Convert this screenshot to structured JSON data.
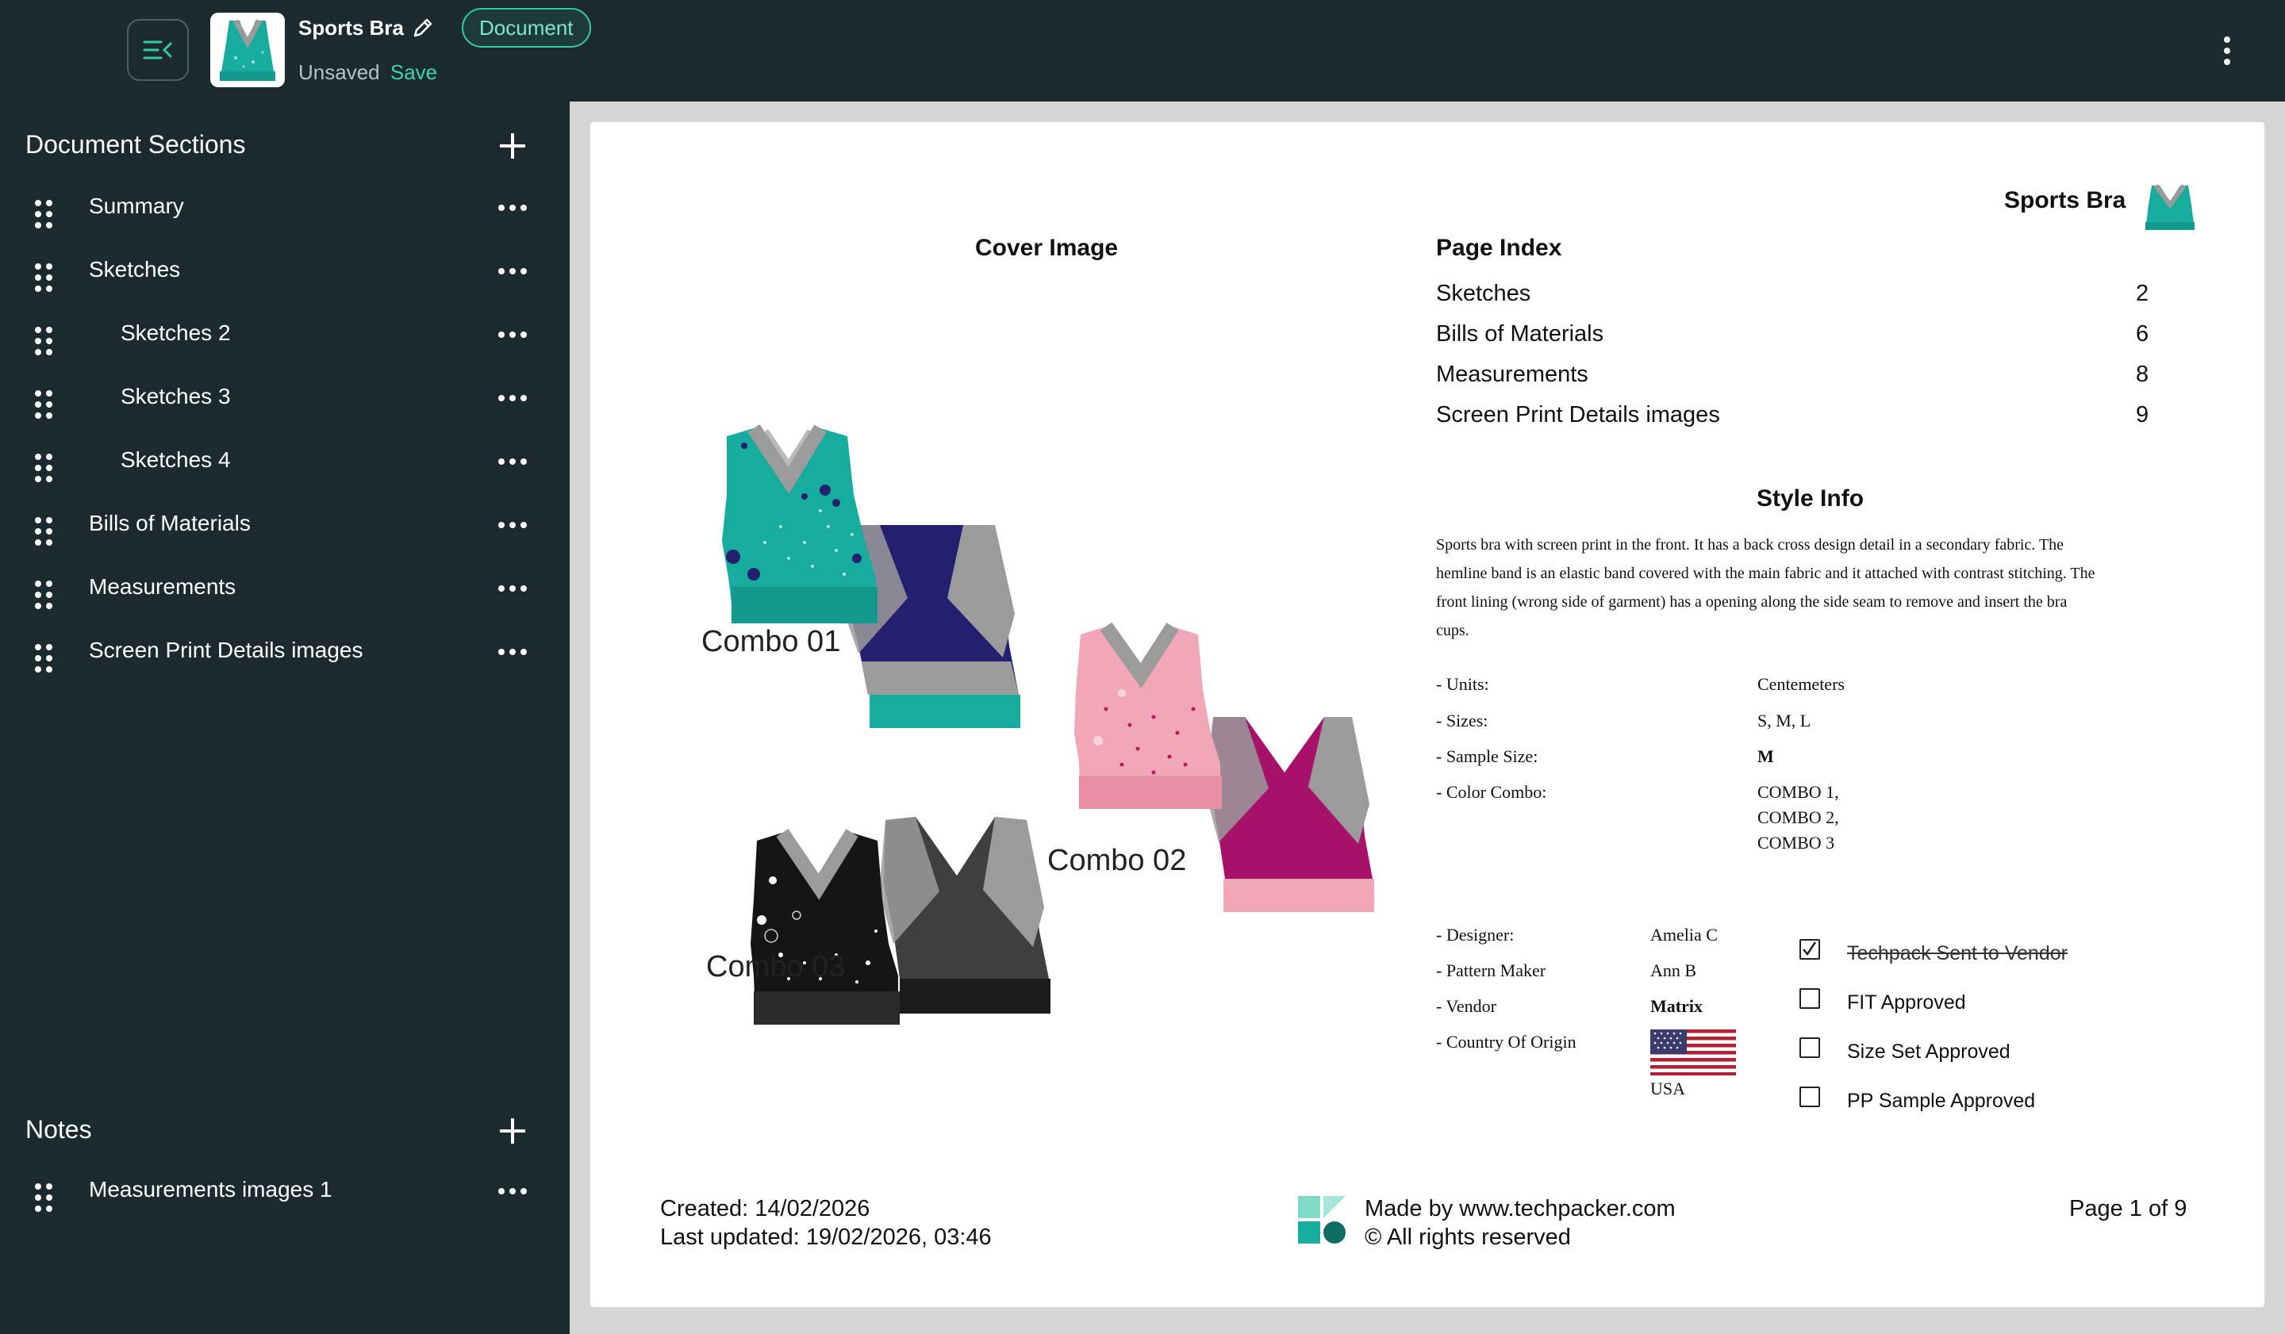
{
  "header": {
    "doc_title": "Sports Bra",
    "badge": "Document",
    "unsaved_text": "Unsaved",
    "save_label": "Save"
  },
  "sidebar": {
    "sections_title": "Document Sections",
    "items": [
      {
        "label": "Summary"
      },
      {
        "label": "Sketches"
      },
      {
        "label": "Sketches 2"
      },
      {
        "label": "Sketches 3"
      },
      {
        "label": "Sketches 4"
      },
      {
        "label": "Bills of Materials"
      },
      {
        "label": "Measurements"
      },
      {
        "label": "Screen Print Details images"
      }
    ],
    "notes_title": "Notes",
    "notes_items": [
      {
        "label": "Measurements images 1"
      }
    ]
  },
  "page": {
    "product_name": "Sports Bra",
    "cover_title": "Cover Image",
    "combos": [
      "Combo 01",
      "Combo 02",
      "Combo 03"
    ],
    "index_title": "Page Index",
    "index": [
      {
        "name": "Sketches",
        "page": "2"
      },
      {
        "name": "Bills of Materials",
        "page": "6"
      },
      {
        "name": "Measurements",
        "page": "8"
      },
      {
        "name": "Screen Print Details images",
        "page": "9"
      }
    ],
    "style_info_title": "Style Info",
    "description_lines": [
      "Sports bra with screen print in the front. It has a back cross design detail in a secondary fabric. The",
      "hemline band is an elastic band covered with the main fabric and it attached with contrast stitching. The",
      "front lining (wrong side of garment) has a opening along the side seam to remove and insert the bra",
      "cups."
    ],
    "specs": {
      "units_label": " - Units:",
      "units_value": "Centemeters",
      "sizes_label": " - Sizes:",
      "sizes_value": "S, M, L",
      "sample_label": " - Sample Size:",
      "sample_value": "M",
      "color_label": " - Color Combo:",
      "color_values": [
        "COMBO 1,",
        "COMBO 2,",
        "COMBO 3"
      ]
    },
    "people": {
      "designer_label": " - Designer:",
      "designer_value": "Amelia C",
      "pattern_label": " - Pattern Maker",
      "pattern_value": "Ann B",
      "vendor_label": " - Vendor",
      "vendor_value": "Matrix",
      "country_label": " - Country Of Origin",
      "country_value": "USA"
    },
    "approvals": [
      {
        "label": "Techpack Sent to Vendor",
        "checked": true
      },
      {
        "label": "FIT Approved",
        "checked": false
      },
      {
        "label": "Size Set Approved",
        "checked": false
      },
      {
        "label": "PP Sample Approved",
        "checked": false
      }
    ],
    "footer": {
      "created": "Created: 14/02/2026",
      "updated": "Last updated: 19/02/2026, 03:46",
      "made_by": "Made by www.techpacker.com",
      "rights": "© All rights reserved",
      "page_num": "Page 1 of 9"
    }
  },
  "colors": {
    "teal": "#17ad9e",
    "navy": "#23206f",
    "pink": "#f2a7b7",
    "magenta": "#a8116a",
    "black": "#151515",
    "grey": "#9b9b9b",
    "sidebar_bg": "#1a2a2e",
    "accent": "#34c9a9"
  }
}
